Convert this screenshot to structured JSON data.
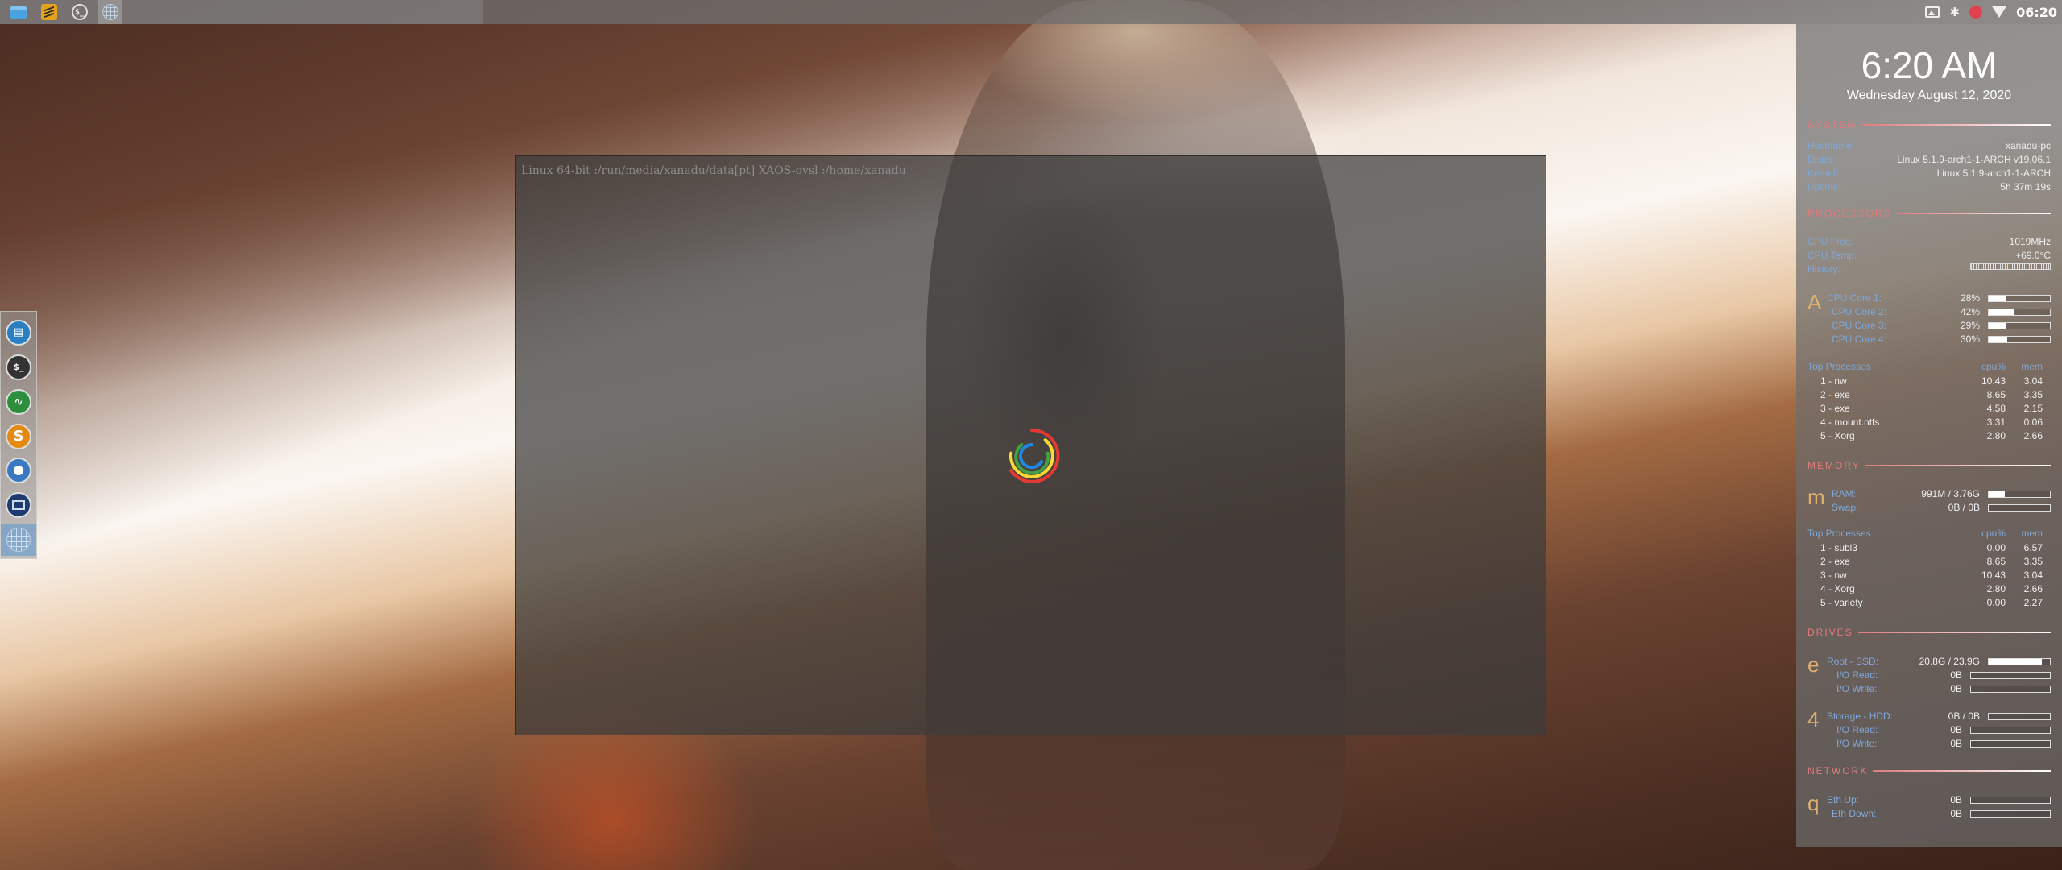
{
  "taskbar": {
    "icons": [
      "folder-icon",
      "sublime-text-icon",
      "terminal-icon",
      "globe-icon"
    ]
  },
  "tray": {
    "clock": "06:20",
    "icons": [
      "image-viewer-icon",
      "bluetooth-icon",
      "bug-icon",
      "wifi-icon"
    ]
  },
  "dock": {
    "items": [
      "files-app",
      "terminal-app",
      "system-monitor-app",
      "sublime-text-app",
      "chrome-app",
      "screen-app",
      "xaos-globe-app"
    ],
    "terminal_glyph": "$_",
    "sublime_glyph": "S"
  },
  "window": {
    "title": "Linux 64-bit :/run/media/xanadu/data[pt] XAOS-ovsl :/home/xanadu"
  },
  "conky": {
    "time": "6:20 AM",
    "date": "Wednesday August 12, 2020",
    "system": {
      "header": "SYSTEM",
      "hostname_label": "Hostname:",
      "hostname": "xanadu-pc",
      "distro_label": "Distro:",
      "distro": "Linux 5.1.9-arch1-1-ARCH v19.06.1",
      "kernel_label": "Kernel:",
      "kernel": "Linux 5.1.9-arch1-1-ARCH",
      "uptime_label": "Uptime:",
      "uptime": "5h 37m 19s"
    },
    "processors": {
      "header": "PROCESSORS",
      "freq_label": "CPU Freq:",
      "freq": "1019MHz",
      "temp_label": "CPU Temp:",
      "temp": "+69.0°C",
      "history_label": "History:",
      "letter": "A",
      "cores": [
        {
          "label": "CPU Core 1:",
          "pct": "28%",
          "value": 0.28
        },
        {
          "label": "CPU Core 2:",
          "pct": "42%",
          "value": 0.42
        },
        {
          "label": "CPU Core 3:",
          "pct": "29%",
          "value": 0.29
        },
        {
          "label": "CPU Core 4:",
          "pct": "30%",
          "value": 0.3
        }
      ],
      "top_label": "Top Processes",
      "cpu_col": "cpu%",
      "mem_col": "mem",
      "top": [
        {
          "name": "1  -  nw",
          "cpu": "10.43",
          "mem": "3.04"
        },
        {
          "name": "2  -  exe",
          "cpu": "8.65",
          "mem": "3.35"
        },
        {
          "name": "3  -  exe",
          "cpu": "4.58",
          "mem": "2.15"
        },
        {
          "name": "4  -  mount.ntfs",
          "cpu": "3.31",
          "mem": "0.06"
        },
        {
          "name": "5  -  Xorg",
          "cpu": "2.80",
          "mem": "2.66"
        }
      ]
    },
    "memory": {
      "header": "MEMORY",
      "letter": "m",
      "ram_label": "RAM:",
      "ram": "991M / 3.76G",
      "ram_value": 0.26,
      "swap_label": "Swap:",
      "swap": "0B / 0B",
      "swap_value": 0,
      "top_label": "Top Processes",
      "cpu_col": "cpu%",
      "mem_col": "mem",
      "top": [
        {
          "name": "1  -  subl3",
          "cpu": "0.00",
          "mem": "6.57"
        },
        {
          "name": "2  -  exe",
          "cpu": "8.65",
          "mem": "3.35"
        },
        {
          "name": "3  -  nw",
          "cpu": "10.43",
          "mem": "3.04"
        },
        {
          "name": "4  -  Xorg",
          "cpu": "2.80",
          "mem": "2.66"
        },
        {
          "name": "5  -  variety",
          "cpu": "0.00",
          "mem": "2.27"
        }
      ]
    },
    "drives": {
      "header": "DRIVES",
      "root_letter": "e",
      "root_label": "Root  -  SSD:",
      "root": "20.8G / 23.9G",
      "root_value": 0.87,
      "root_read_label": "I/O Read:",
      "root_read": "0B",
      "root_write_label": "I/O Write:",
      "root_write": "0B",
      "storage_letter": "4",
      "storage_label": "Storage  -  HDD:",
      "storage": "0B / 0B",
      "storage_value": 0,
      "storage_read_label": "I/O Read:",
      "storage_read": "0B",
      "storage_write_label": "I/O Write:",
      "storage_write": "0B"
    },
    "network": {
      "header": "NETWORK",
      "letter": "q",
      "up_label": "Eth Up:",
      "up": "0B",
      "down_label": "Eth Down:",
      "down": "0B"
    }
  },
  "colors": {
    "section_header": "#e07a7a",
    "label_blue": "#7fa7d8",
    "letter_gold": "#e0b070"
  }
}
